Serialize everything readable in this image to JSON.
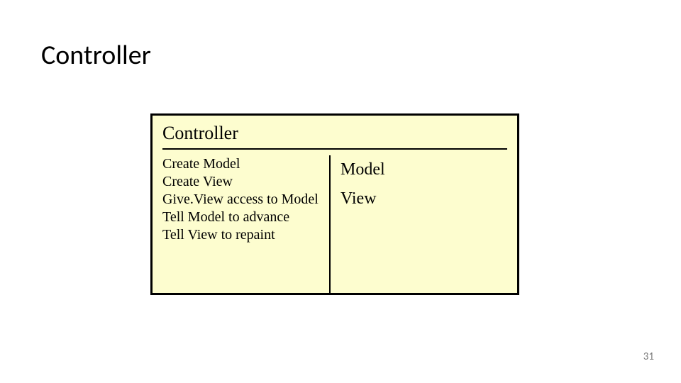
{
  "title": "Controller",
  "card": {
    "name": "Controller",
    "responsibilities": [
      "Create Model",
      "Create View",
      "Give.View access to Model",
      "Tell Model to advance",
      "Tell View to repaint"
    ],
    "collaborators": [
      "Model",
      "View"
    ]
  },
  "page_number": "31"
}
